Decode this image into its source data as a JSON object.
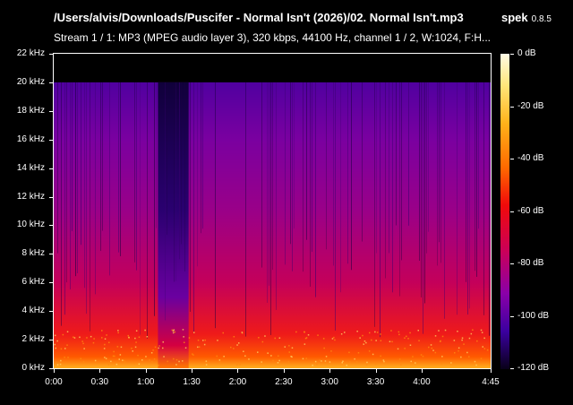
{
  "header": {
    "file_path": "/Users/alvis/Downloads/Puscifer - Normal Isn't (2026)/02. Normal Isn't.mp3",
    "app_name": "spek",
    "app_version": "0.8.5",
    "stream_info": "Stream 1 / 1: MP3 (MPEG audio layer 3), 320 kbps, 44100 Hz, channel 1 / 2, W:1024, F:H..."
  },
  "chart_data": {
    "type": "heatmap",
    "y_axis": {
      "unit": "kHz",
      "range": [
        0,
        22
      ],
      "ticks": [
        "22 kHz",
        "20 kHz",
        "18 kHz",
        "16 kHz",
        "14 kHz",
        "12 kHz",
        "10 kHz",
        "8 kHz",
        "6 kHz",
        "4 kHz",
        "2 kHz",
        "0 kHz"
      ]
    },
    "x_axis": {
      "range_seconds": [
        0,
        285
      ],
      "ticks": [
        "0:00",
        "0:30",
        "1:00",
        "1:30",
        "2:00",
        "2:30",
        "3:00",
        "3:30",
        "4:00",
        "4:45"
      ]
    },
    "color_scale": {
      "unit": "dB",
      "range": [
        -120,
        0
      ],
      "ticks": [
        "0 dB",
        "-20 dB",
        "-40 dB",
        "-60 dB",
        "-80 dB",
        "-100 dB",
        "-120 dB"
      ]
    },
    "cutoff_khz": 20,
    "quiet_section": {
      "start": "1:08",
      "end": "1:28"
    }
  }
}
